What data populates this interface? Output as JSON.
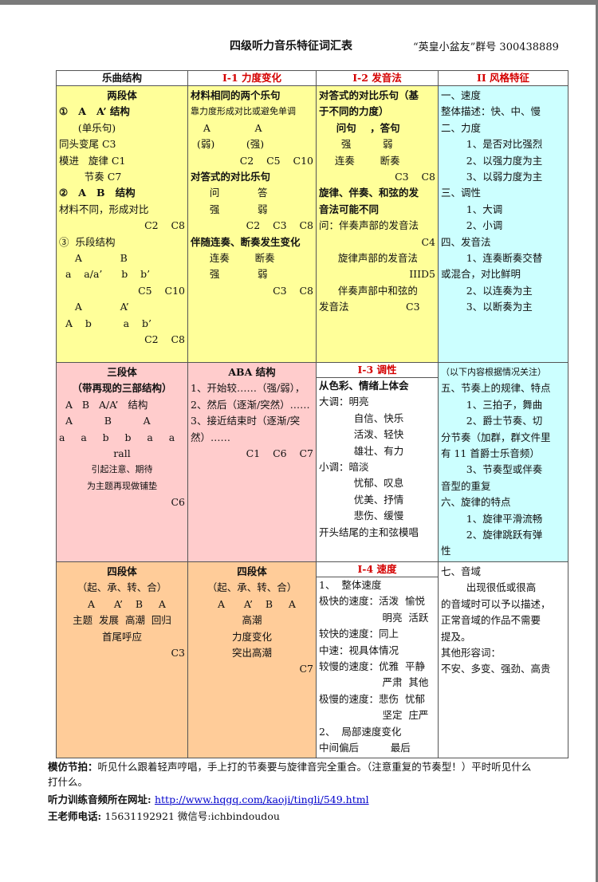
{
  "header": {
    "title": "四级听力音乐特征词汇表",
    "group": "“英皇小盆友”群号 300438889"
  },
  "table": {
    "headers": [
      "乐曲结构",
      "I-1 力度变化",
      "I-2 发音法",
      "II 风格特征"
    ],
    "row1": {
      "c1": [
        "两段体",
        "①   A   A’ 结构",
        "      (单乐句)",
        "同头变尾 C3",
        "模进   旋律 C1",
        "        节奏 C7",
        "②   A   B   结构",
        "材料不同，形成对比",
        "C2    C8",
        "③  乐段结构",
        "     A            B",
        "  a    a/a’      b    b’",
        "C5    C10",
        "     A            A’",
        "  A    b          a    b’",
        "C2    C8"
      ],
      "c2": [
        "材料相同的两个乐句",
        "靠力度形成对比或避免单调",
        "    A              A",
        "  (弱)          (强)",
        "C2    C5    C10",
        "对答式的对比乐句",
        "      问            答",
        "      强            弱",
        "C2    C3    C8",
        "伴随连奏、断奏发生变化",
        "      连奏        断奏",
        "      强            弱",
        "C3    C8"
      ],
      "c3": [
        "对答式的对比乐句（基",
        "于不同的力度）",
        "     问句    ，答句",
        "       强          弱",
        "     连奏        断奏",
        "C3    C8",
        "",
        "旋律、伴奏、和弦的发",
        "音法可能不同",
        "问：伴奏声部的发音法",
        "C4",
        "      旋律声部的发音法",
        "IIID5",
        "      伴奏声部中和弦的",
        "发音法                  C3"
      ],
      "c4": [
        "一、速度",
        "整体描述：快、中、慢",
        "",
        "二、力度",
        "        1、是否对比强烈",
        "        2、以强力度为主",
        "        3、以弱力度为主",
        "",
        "三、调性",
        "        1、大调",
        "        2、小调",
        "",
        "四、发音法",
        "        1、连奏断奏交替",
        "或混合，对比鲜明",
        "        2、以连奏为主",
        "        3、以断奏为主"
      ]
    },
    "row2": {
      "c1": [
        "三段体",
        "（带再现的三部结构）",
        "  A   B   A/A’   结构",
        "",
        "  A          B          A",
        "a     a     b     b     a     a",
        "rall",
        "引起注意、期待",
        "为主题再现做铺垫",
        "",
        "C6"
      ],
      "c2": [
        "ABA 结构",
        "1、开始较……（强/弱），",
        "2、然后（逐渐/突然）……",
        "3、接近结束时（逐渐/突",
        "然）……",
        "C1    C6    C7"
      ],
      "c3_title": "I-3  调性",
      "c3": [
        "从色彩、情绪上体会",
        "大调：明亮",
        "           自信、快乐",
        "           活泼、轻快",
        "           雄壮、有力",
        "小调：暗淡",
        "           忧郁、叹息",
        "           优美、抒情",
        "           悲伤、缓慢",
        "开头结尾的主和弦模唱"
      ],
      "c4": [
        "（以下内容根据情况关注）",
        "五、节奏上的规律、特点",
        "        1、三拍子，舞曲",
        "        2、爵士节奏、切",
        "分节奏（加群，群文件里",
        "有 11 首爵士乐音频）",
        "        3、节奏型或伴奏",
        "音型的重复",
        "六、旋律的特点",
        "        1、旋律平滑流畅",
        "        2、旋律跳跃有弹",
        "性"
      ]
    },
    "row3": {
      "c1": [
        "四段体",
        "（起、承、转、合）",
        "",
        "   A      A’    B     A",
        "主题  发展  高潮  回归",
        "",
        "首尾呼应",
        "C3"
      ],
      "c2": [
        "四段体",
        "（起、承、转、合）",
        "",
        "   A      A’    B     A",
        "高潮",
        "力度变化",
        "突出高潮",
        "C7"
      ],
      "c3_title": "I-4 速度",
      "c3": [
        "1、  整体速度",
        "极快的速度：活泼  愉悦",
        "                    明亮  活跃",
        "较快的速度：同上",
        "中速：视具体情况",
        "较慢的速度：优雅  平静",
        "                    严肃  其他",
        "极慢的速度：悲伤  忧郁",
        "                    坚定  庄严",
        "2、  局部速度变化",
        "中间偏后          最后"
      ],
      "c4": [
        "七、音域",
        "        出现很低或很高",
        "的音域时可以予以描述，",
        "正常音域的作品不需要",
        "提及。",
        "",
        "",
        "其他形容词：",
        "不安、多变、强劲、高贵"
      ]
    }
  },
  "footer": {
    "line1_bold": "模仿节拍：",
    "line1_text": "听见什么跟着轻声哼唱，手上打的节奏要与旋律音完全重合。（注意重复的节奏型！）平时听见什么",
    "line1_cont": "打什么。",
    "line2_bold": "听力训练音频所在网址: ",
    "line2_link": "http://www.hqgq.com/kaoji/tingli/549.html",
    "line3_bold": "王老师电话: ",
    "line3_text": "15631192921    微信号:ichbindoudou"
  },
  "colors": {
    "yellow": "#ffff99",
    "pink": "#ffcccc",
    "orange": "#ffcc99",
    "cyan": "#ccffff",
    "header_red": "#d40000",
    "link": "#0000cc"
  }
}
